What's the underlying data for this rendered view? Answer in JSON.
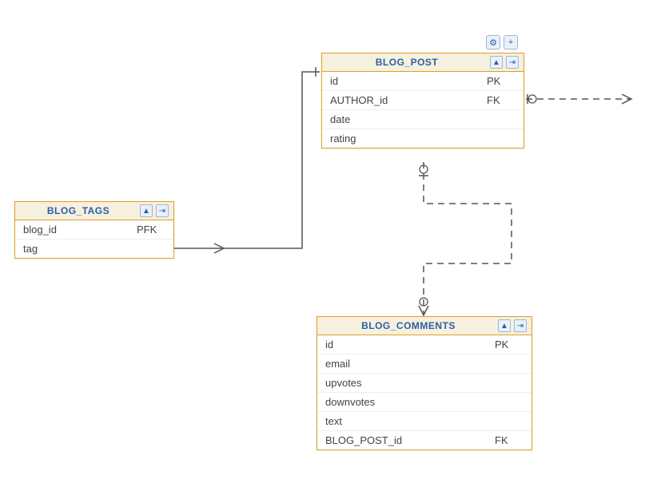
{
  "toolbar": {
    "gear_icon": "⚙",
    "plus_icon": "+"
  },
  "header_icons": {
    "collapse": "▲",
    "details": "⇥"
  },
  "entities": {
    "blog_post": {
      "title": "BLOG_POST",
      "rows": [
        {
          "name": "id",
          "key": "PK"
        },
        {
          "name": "AUTHOR_id",
          "key": "FK"
        },
        {
          "name": "date",
          "key": ""
        },
        {
          "name": "rating",
          "key": ""
        }
      ]
    },
    "blog_tags": {
      "title": "BLOG_TAGS",
      "rows": [
        {
          "name": "blog_id",
          "key": "PFK"
        },
        {
          "name": "tag",
          "key": ""
        }
      ]
    },
    "blog_comments": {
      "title": "BLOG_COMMENTS",
      "rows": [
        {
          "name": "id",
          "key": "PK"
        },
        {
          "name": "email",
          "key": ""
        },
        {
          "name": "upvotes",
          "key": ""
        },
        {
          "name": "downvotes",
          "key": ""
        },
        {
          "name": "text",
          "key": ""
        },
        {
          "name": "BLOG_POST_id",
          "key": "FK"
        }
      ]
    }
  }
}
